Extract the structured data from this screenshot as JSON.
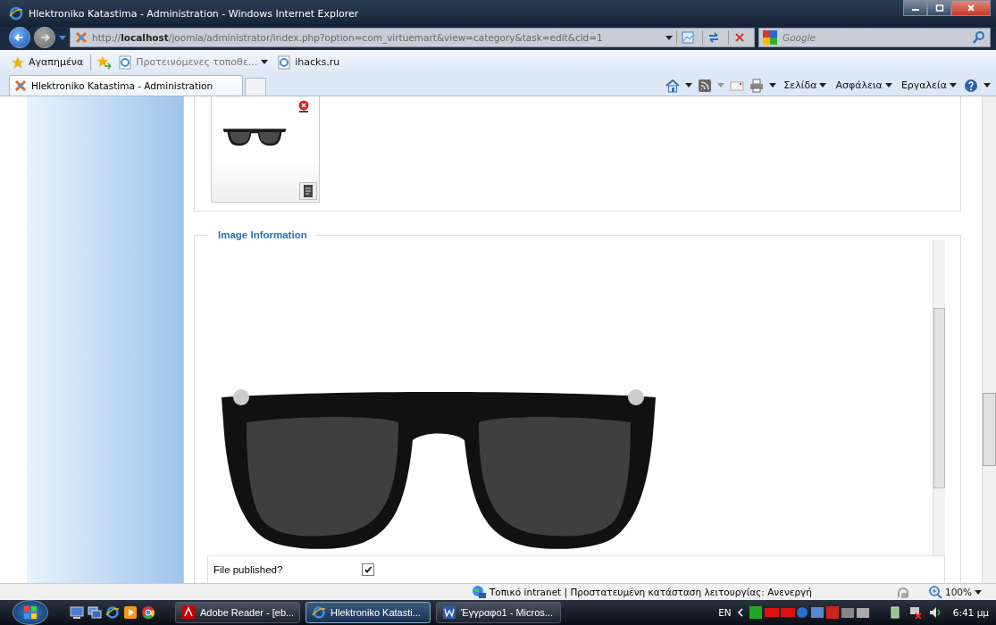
{
  "window": {
    "title": "Hlektroniko Katastima - Administration - Windows Internet Explorer"
  },
  "address_bar": {
    "url": "http://**localhost**/joomla/administrator/index.php?option=com_virtuemart&view=category&task=edit&cid=1"
  },
  "search": {
    "placeholder": "Google"
  },
  "favorites_bar": {
    "favorites": "Αγαπημένα",
    "links": [
      "Προτεινόμενες τοποθε...",
      "ihacks.ru"
    ]
  },
  "tabs": [
    {
      "label": "Hlektroniko Katastima - Administration",
      "selected": true
    }
  ],
  "command_bar": {
    "menus": [
      "Σελίδα",
      "Ασφάλεια",
      "Εργαλεία"
    ]
  },
  "content": {
    "section_title": "Image Information",
    "published": {
      "label": "File published?",
      "checked": true
    }
  },
  "status_bar": {
    "zone": "Τοπικό intranet | Προστατευμένη κατάσταση λειτουργίας: Ανενεργή",
    "zoom": "100%"
  },
  "taskbar": {
    "windows": [
      {
        "label": "Adobe Reader - [eb...",
        "selected": false,
        "kind": "pdf"
      },
      {
        "label": "Hlektroniko Katasti...",
        "selected": true,
        "kind": "ie"
      },
      {
        "label": "Έγγραφο1 - Micros...",
        "selected": false,
        "kind": "word"
      }
    ],
    "language": "EN",
    "clock": "6:41 μμ"
  }
}
